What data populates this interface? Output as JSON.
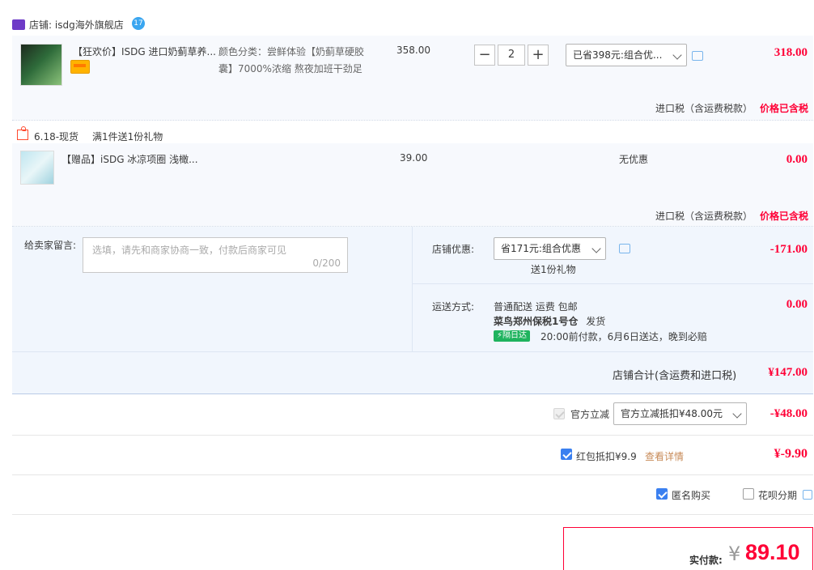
{
  "shop": {
    "label": "店铺:",
    "name": "isdg海外旗舰店"
  },
  "item1": {
    "title": "【狂欢价】ISDG 进口奶蓟草养...",
    "sku_line1": "颜色分类：尝鲜体验【奶蓟草硬胶",
    "sku_line2": "囊】7000%浓缩 熬夜加班干劲足",
    "unit_price": "358.00",
    "qty": "2",
    "promo": "已省398元:组合优...",
    "total": "318.00",
    "tax_label": "进口税（含运费税款）",
    "tax_value": "价格已含税"
  },
  "gift_promo": {
    "tag": "6.18-现货",
    "text": "满1件送1份礼物"
  },
  "item2": {
    "title": "【赠品】iSDG 冰凉项圈 浅橄...",
    "unit_price": "39.00",
    "promo": "无优惠",
    "total": "0.00",
    "tax_label": "进口税（含运费税款）",
    "tax_value": "价格已含税"
  },
  "message": {
    "label": "给卖家留言:",
    "placeholder": "选填，请先和商家协商一致，付款后商家可见",
    "counter": "0/200"
  },
  "shop_discount": {
    "label": "店铺优惠:",
    "value": "省171元:组合优惠",
    "sub": "送1份礼物",
    "amount": "-171.00"
  },
  "shipping": {
    "label": "运送方式:",
    "method": "普通配送 运费 包邮",
    "warehouse": "菜鸟郑州保税1号仓",
    "ship_text": "发货",
    "badge": "隔日达",
    "eta": "20:00前付款，6月6日送达，晚到必赔",
    "amount": "0.00"
  },
  "shop_total": {
    "label": "店铺合计(含运费和进口税)",
    "amount": "¥147.00"
  },
  "official": {
    "label": "官方立减",
    "select": "官方立减抵扣¥48.00元",
    "amount": "-¥48.00"
  },
  "redpacket": {
    "label": "红包抵扣¥9.9",
    "link": "查看详情",
    "amount": "¥-9.90"
  },
  "options": {
    "anonymous": "匿名购买",
    "huabei": "花呗分期"
  },
  "payment": {
    "label": "实付款:",
    "currency": "¥",
    "amount": "89.10"
  },
  "colors": {
    "accent_red": "#ff0036",
    "blue": "#3b80f0",
    "row_bg": "#f7f9fd",
    "promo_bg": "#f1f6fd"
  },
  "icons": [
    "shop-icon",
    "wangwang-icon",
    "credit-card-icon",
    "chat-icon",
    "gift-icon",
    "chevron-down-icon",
    "lightning-icon",
    "checkbox-icon"
  ]
}
